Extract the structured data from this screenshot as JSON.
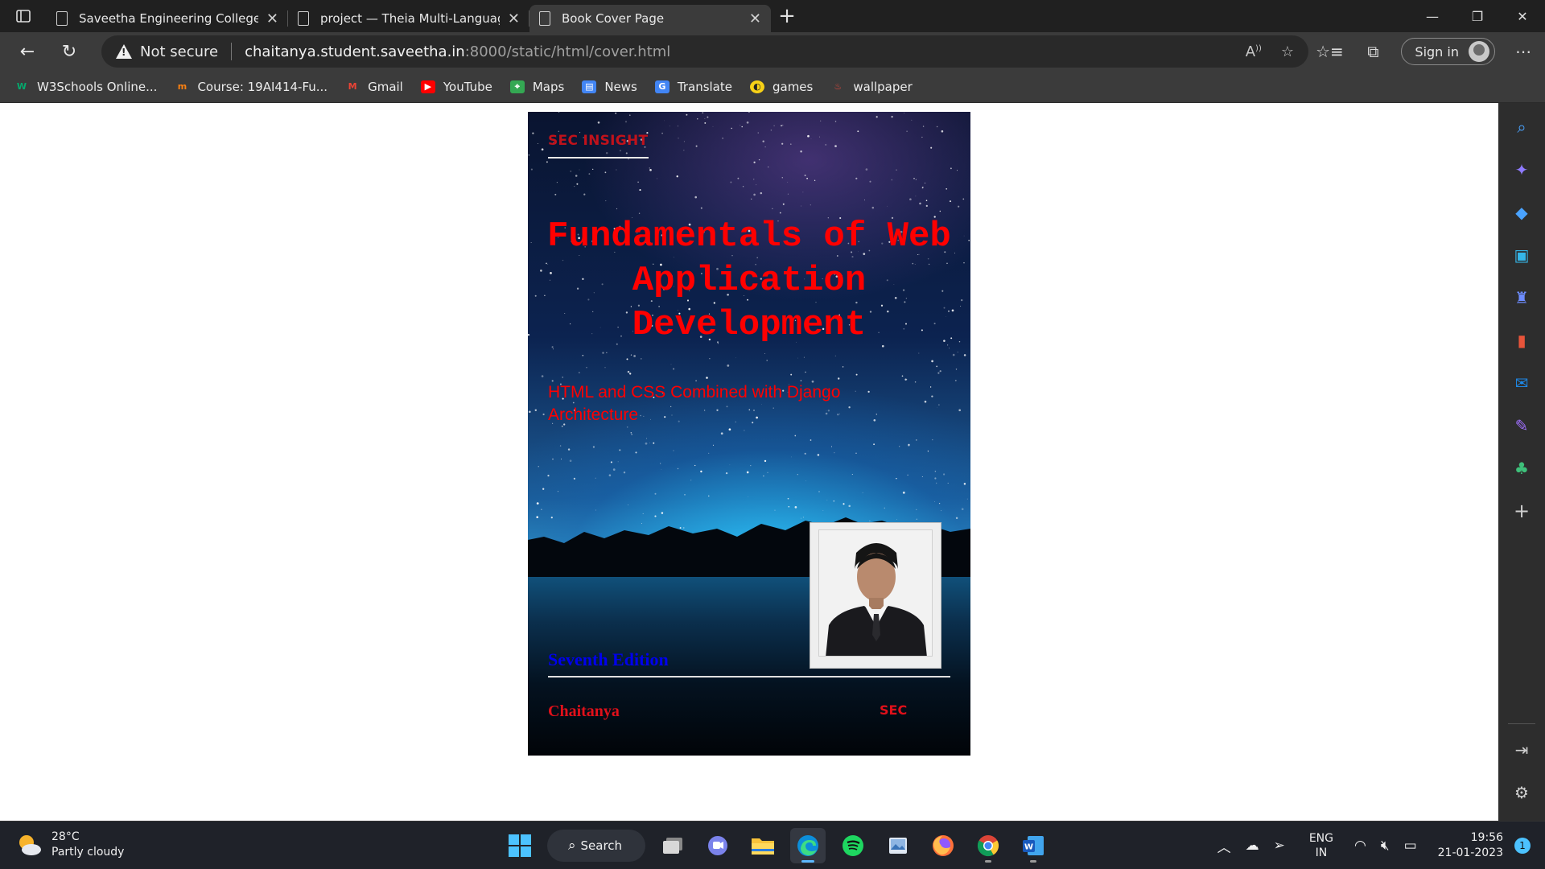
{
  "browser": {
    "tabs": [
      {
        "label": "Saveetha Engineering College",
        "active": false
      },
      {
        "label": "project — Theia Multi-Language",
        "active": false
      },
      {
        "label": "Book Cover Page",
        "active": true
      }
    ],
    "address": {
      "security": "Not secure",
      "host": "chaitanya.student.saveetha.in",
      "rest": ":8000/static/html/cover.html"
    },
    "signin_label": "Sign in",
    "favorites": [
      {
        "label": "W3Schools Online...",
        "icon": "w3schools-icon",
        "color": "#04aa6d"
      },
      {
        "label": "Course: 19AI414-Fu...",
        "icon": "moodle-icon",
        "color": "#f98012"
      },
      {
        "label": "Gmail",
        "icon": "gmail-icon",
        "color": "#ea4335"
      },
      {
        "label": "YouTube",
        "icon": "youtube-icon",
        "color": "#ff0000"
      },
      {
        "label": "Maps",
        "icon": "maps-icon",
        "color": "#34a853"
      },
      {
        "label": "News",
        "icon": "news-icon",
        "color": "#4285f4"
      },
      {
        "label": "Translate",
        "icon": "translate-icon",
        "color": "#4285f4"
      },
      {
        "label": "games",
        "icon": "games-icon",
        "color": "#f7d117"
      },
      {
        "label": "wallpaper",
        "icon": "wallpaper-icon",
        "color": "#e8483c"
      }
    ]
  },
  "cover": {
    "series": "SEC INSIGHT",
    "title": "Fundamentals of Web Application Development",
    "subtitle": "HTML and CSS Combined with Django Architecture",
    "edition": "Seventh Edition",
    "author": "Chaitanya",
    "publisher": "SEC",
    "colors": {
      "title": "#ff0000",
      "edition": "#0000ee"
    }
  },
  "taskbar": {
    "weather_temp": "28°C",
    "weather_desc": "Partly cloudy",
    "search_label": "Search",
    "lang_1": "ENG",
    "lang_2": "IN",
    "time": "19:56",
    "date": "21-01-2023",
    "notification_count": "1"
  }
}
